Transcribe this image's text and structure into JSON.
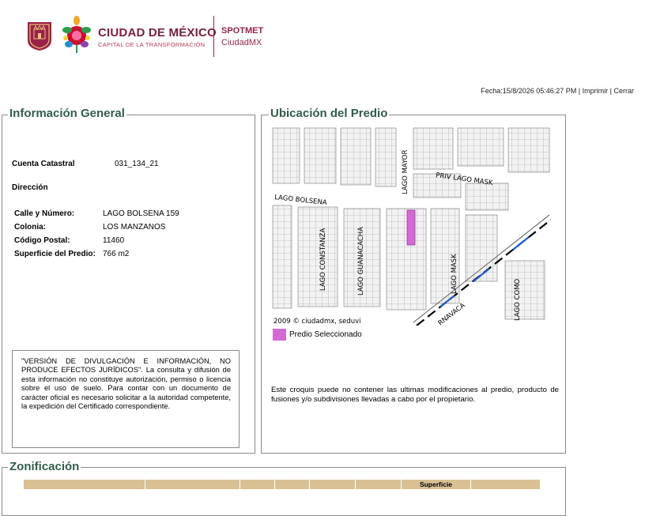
{
  "header": {
    "city_title": "CIUDAD DE MÉXICO",
    "city_subtitle": "CAPITAL DE LA TRANSFORMACIÓN",
    "app_title": "SPOTMET",
    "app_subtitle": "CiudadMX"
  },
  "topbar": {
    "fecha": "Fecha:15/8/2026 05:46:27 PM",
    "sep": " | ",
    "imprimir": "Imprimir",
    "cerrar": "Cerrar"
  },
  "general": {
    "legend": "Información General",
    "cuenta_label": "Cuenta Catastral",
    "cuenta_value": "031_134_21",
    "direccion_label": "Dirección",
    "rows": [
      {
        "label": "Calle y Número:",
        "value": "LAGO BOLSENA 159"
      },
      {
        "label": "Colonia:",
        "value": "LOS MANZANOS"
      },
      {
        "label": "Código Postal:",
        "value": "11460"
      },
      {
        "label": "Superficie del Predio:",
        "value": "766 m2"
      }
    ],
    "disclaimer": "\"VERSIÓN DE DIVULGACIÓN E INFORMACIÓN, NO PRODUCE EFECTOS JURÍDICOS\". La consulta y difusión de esta información no constituye autorización, permiso o licencia sobre el uso de suelo. Para contar con un documento de carácter oficial es necesario solicitar a la autoridad competente, la expedición del Certificado correspondiente."
  },
  "ubicacion": {
    "legend": "Ubicación del Predio",
    "map_labels": {
      "lago_mayor": "LAGO MAYOR",
      "priv_lago_mask": "PRIV LAGO MASK",
      "lago_bolsena": "LAGO BOLSENA",
      "lago_constanza": "LAGO CONSTANZA",
      "lago_guanacacha": "LAGO GUANACACHA",
      "lago_mask": "LAGO MASK",
      "lago_como": "LAGO COMO",
      "rnavaca": "RNAVACA",
      "copyright": "2009 © ciudadmx, seduvi"
    },
    "legend_item": "Predio Seleccionado",
    "note": "Este croquis puede no contener las ultimas modificaciones al predio, producto de fusiones y/o subdivisiones llevadas a cabo por el propietario.",
    "colors": {
      "predio": "#d36ad3",
      "railway_blue": "#1f5fd0",
      "street_fill": "#ffffff",
      "block_fill": "#eeeeee"
    }
  },
  "zonificacion": {
    "legend": "Zonificación",
    "headers": [
      "",
      "",
      "",
      "",
      "",
      "",
      "Superficie",
      ""
    ]
  }
}
